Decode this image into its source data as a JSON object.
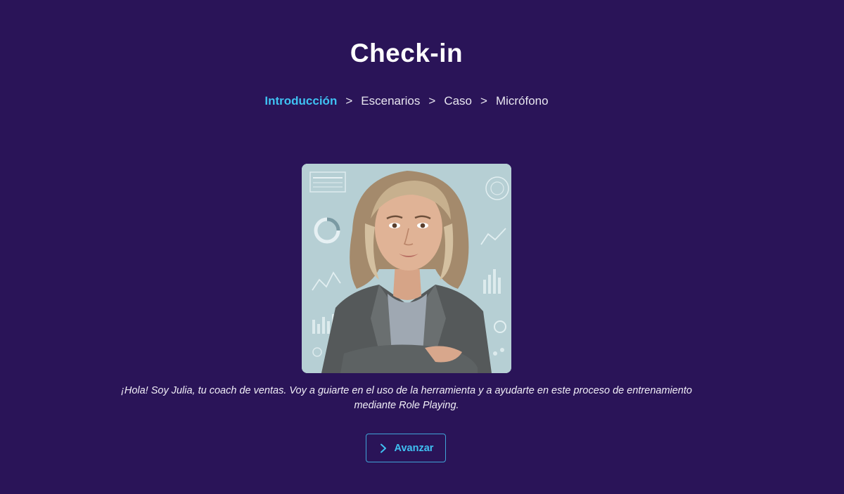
{
  "page": {
    "title": "Check-in"
  },
  "breadcrumb": {
    "items": [
      {
        "label": "Introducción",
        "active": true
      },
      {
        "label": "Escenarios",
        "active": false
      },
      {
        "label": "Caso",
        "active": false
      },
      {
        "label": "Micrófono",
        "active": false
      }
    ],
    "separator": ">"
  },
  "intro": {
    "message_line1": "¡Hola! Soy Julia, tu coach de ventas. Voy a guiarte en el uso de la herramienta y a ayudarte en este proceso de entrenamiento",
    "message_line2": "mediante Role Playing."
  },
  "actions": {
    "advance_label": "Avanzar",
    "advance_icon": "chevron-right-icon"
  },
  "colors": {
    "background": "#2a1458",
    "accent": "#3fc1f2",
    "button_border": "#3fa4d8"
  }
}
